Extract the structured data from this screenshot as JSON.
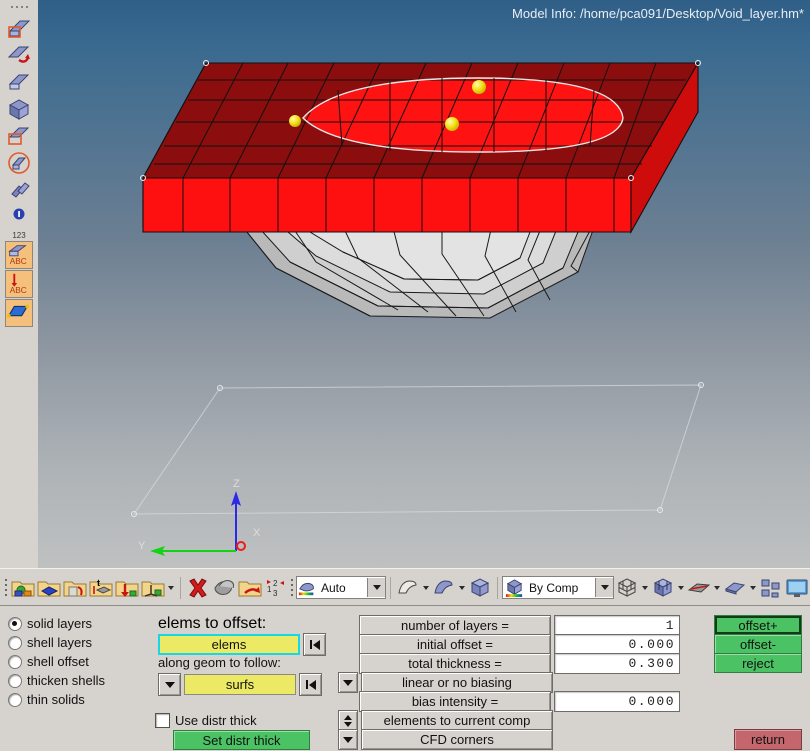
{
  "window": {
    "model_info": "Model Info: /home/pca091/Desktop/Void_layer.hm*"
  },
  "viewport": {
    "axis_triad": {
      "x_label": "X",
      "y_label": "Y",
      "z_label": "Z",
      "x_color": "#ee1c1c",
      "y_color": "#14d314",
      "z_color": "#2a2ae6"
    },
    "background_top": "#2f5f87",
    "background_bottom": "#bfc1c1",
    "solid_color": "#ff1010",
    "solid_top_color": "#8c0d0d",
    "shell_color": "#c9c9c9",
    "node_marker_color": "#f5e11a"
  },
  "left_toolbar": {
    "items": [
      {
        "name": "mesh-element-icon",
        "label": ""
      },
      {
        "name": "mesh-edit-icon",
        "label": ""
      },
      {
        "name": "mesh-faces-icon",
        "label": ""
      },
      {
        "name": "mesh-solid-icon",
        "label": ""
      },
      {
        "name": "mesh-select-icon",
        "label": ""
      },
      {
        "name": "mesh-circle-icon",
        "label": ""
      },
      {
        "name": "mesh-link-icon",
        "label": ""
      },
      {
        "name": "info-number-icon",
        "label": "123"
      },
      {
        "name": "mesh-abc-icon",
        "label": "ABC"
      },
      {
        "name": "arrow-abc-icon",
        "label": "ABC"
      },
      {
        "name": "surface-icon",
        "label": ""
      }
    ]
  },
  "top_toolbar": {
    "left_icons": [
      "component-icon",
      "component-blue-icon",
      "component-wall-icon",
      "component-thickness-icon",
      "component-arrow-icon",
      "component-axis-icon"
    ],
    "mid_icons": [
      "delete-icon",
      "mask-icon",
      "organize-icon",
      "numbers-icon"
    ],
    "visual_mode": {
      "label": "Auto",
      "name": "visualization-mode-combo"
    },
    "geom_icons": [
      "surface-flat-icon",
      "surface-curved-icon",
      "solid-cube-icon"
    ],
    "color_mode": {
      "label": "By Comp",
      "name": "color-mode-combo"
    },
    "view_icons": [
      "wireframe-cube-icon",
      "shaded-cube-icon",
      "feature-lines-icon",
      "shrink-elements-icon",
      "components-icon",
      "screen-icon"
    ]
  },
  "panel": {
    "mode_options": [
      {
        "label": "solid layers",
        "selected": true
      },
      {
        "label": "shell layers",
        "selected": false
      },
      {
        "label": "shell offset",
        "selected": false
      },
      {
        "label": "thicken shells",
        "selected": false
      },
      {
        "label": "thin solids",
        "selected": false
      }
    ],
    "elems_label": "elems to offset:",
    "elems_value": "elems",
    "geom_label": "along geom to follow:",
    "geom_value": "surfs",
    "use_distr_thick_label": "Use distr thick",
    "use_distr_thick_checked": false,
    "set_distr_thick_label": "Set distr thick",
    "fields": [
      {
        "label": "number of layers  =",
        "value": "1"
      },
      {
        "label": "initial offset    =",
        "value": "0.000"
      },
      {
        "label": "total thickness =",
        "value": "0.300"
      }
    ],
    "bias_mode_label": "linear or no biasing",
    "bias_field": {
      "label": "bias intensity   =",
      "value": "0.000"
    },
    "dest_comp_label": "elements to current comp",
    "corners_label": "CFD corners",
    "action_buttons": [
      {
        "label": "offset+",
        "focused": true
      },
      {
        "label": "offset-",
        "focused": false
      },
      {
        "label": "reject",
        "focused": false
      }
    ],
    "return_label": "return"
  }
}
